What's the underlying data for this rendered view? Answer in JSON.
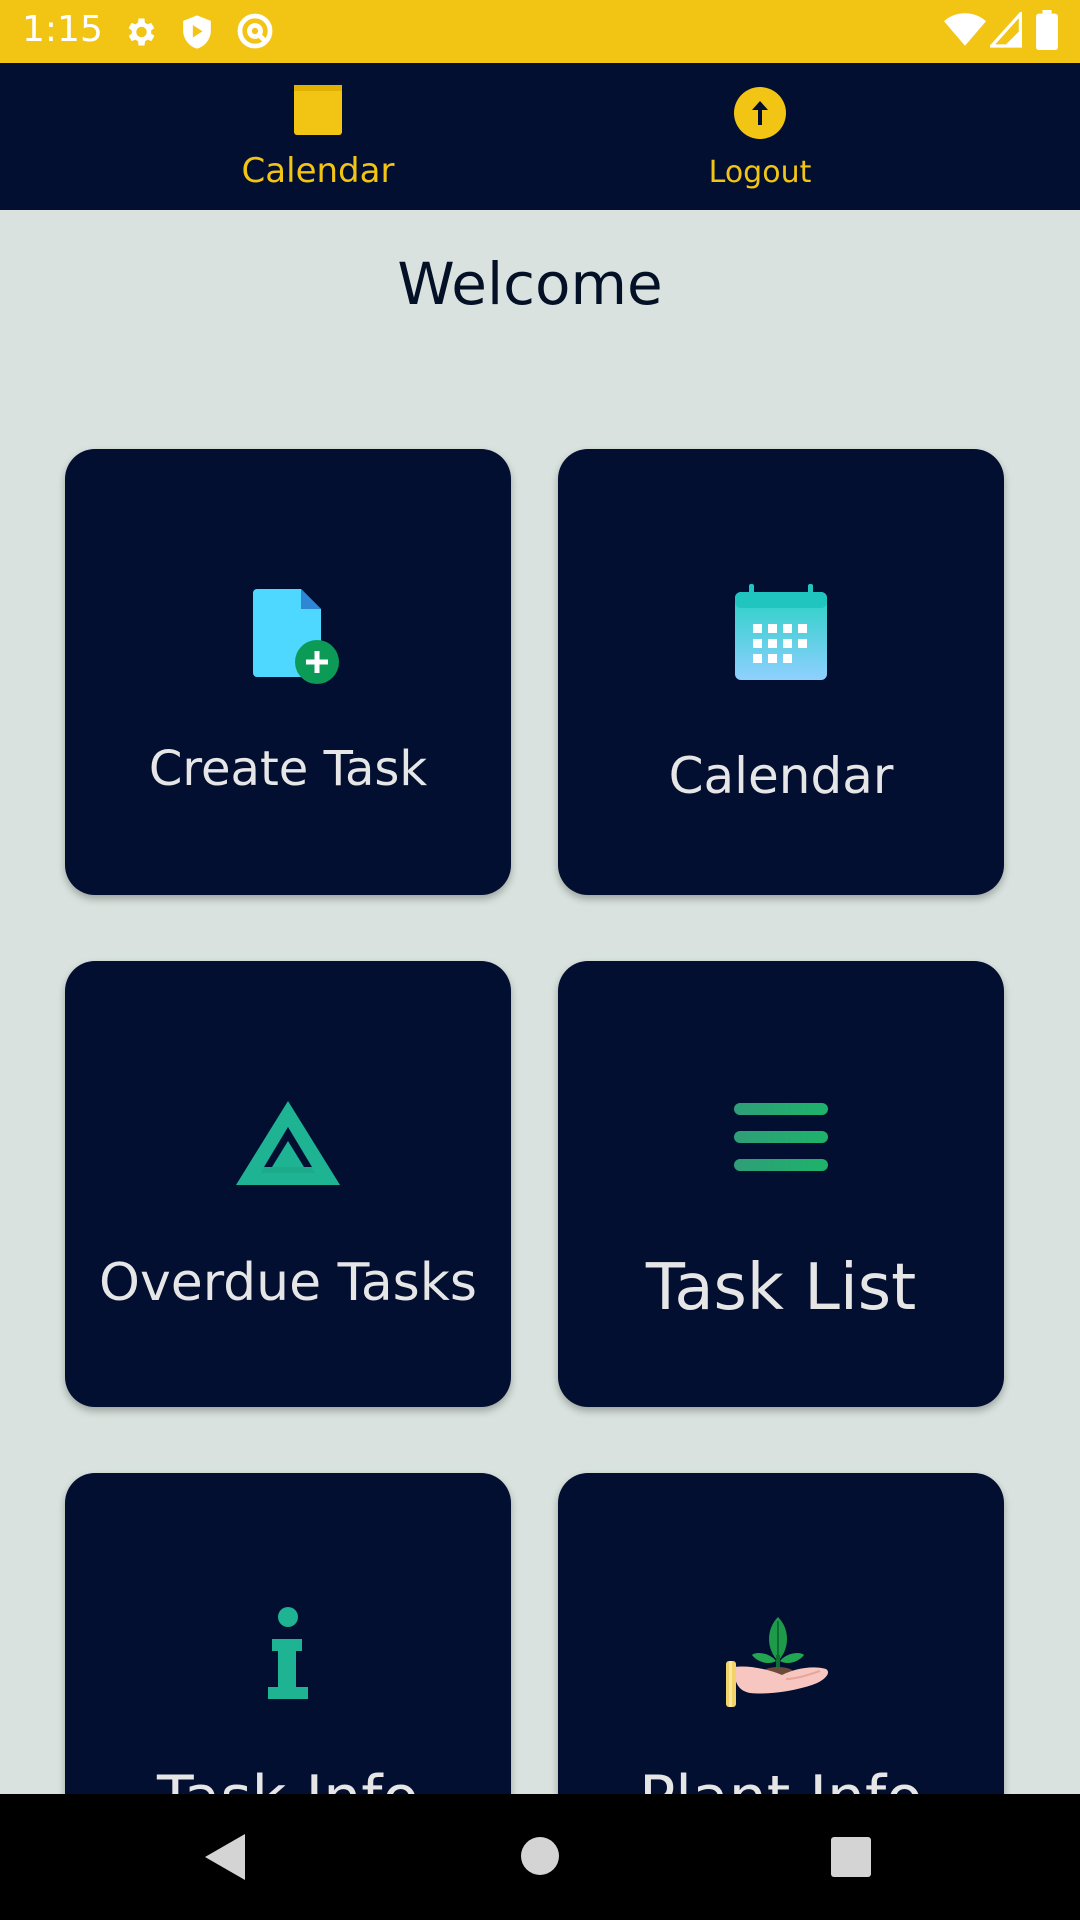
{
  "status_bar": {
    "time": "1:15",
    "icons": [
      "gear-icon",
      "shield-icon",
      "at-sign-icon",
      "wifi-icon",
      "signal-icon",
      "battery-icon"
    ]
  },
  "top_nav": {
    "items": [
      {
        "label": "Calendar",
        "icon": "calendar-icon"
      },
      {
        "label": "Logout",
        "icon": "logout-icon"
      }
    ]
  },
  "welcome": {
    "title": "Welcome"
  },
  "cards": [
    {
      "label": "Create Task",
      "icon": "add-file-icon"
    },
    {
      "label": "Calendar",
      "icon": "calendar-grid-icon"
    },
    {
      "label": "Overdue Tasks",
      "icon": "triangle-icon"
    },
    {
      "label": "Task List",
      "icon": "list-icon"
    },
    {
      "label": "Task Info",
      "icon": "info-icon"
    },
    {
      "label": "Plant Info",
      "icon": "plant-hand-icon"
    }
  ],
  "colors": {
    "status_bar": "#f2c414",
    "nav_background": "#020f31",
    "accent": "#f2c414",
    "page_background": "#d9e2de",
    "card_background": "#020f31",
    "teal": "#1db393"
  },
  "system_nav": {
    "icons": [
      "back-icon",
      "home-icon",
      "recents-icon"
    ]
  }
}
